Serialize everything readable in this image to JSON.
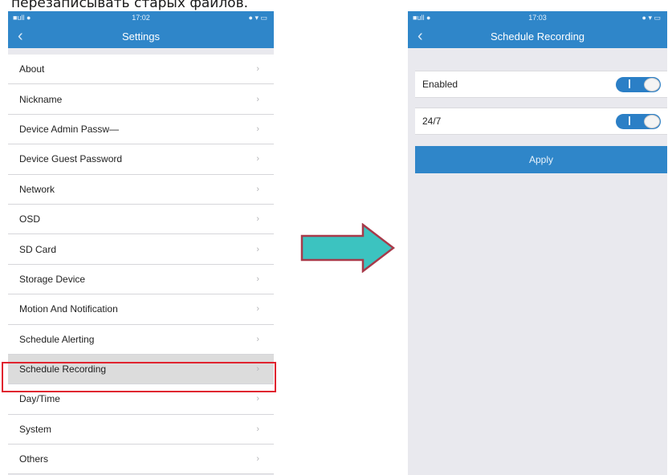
{
  "caption": "перезаписывать старых файлов.",
  "left_screen": {
    "status": {
      "carrier": "■ull ●",
      "time": "17:02",
      "icons": "● ▾ ▭"
    },
    "title": "Settings",
    "back_glyph": "‹",
    "chevron_glyph": "›",
    "items": [
      {
        "label": "About"
      },
      {
        "label": "Nickname"
      },
      {
        "label": "Device Admin Passw—"
      },
      {
        "label": "Device Guest Password"
      },
      {
        "label": "Network"
      },
      {
        "label": "OSD"
      },
      {
        "label": "SD Card"
      },
      {
        "label": "Storage Device"
      },
      {
        "label": "Motion And Notification"
      },
      {
        "label": "Schedule Alerting"
      },
      {
        "label": "Schedule Recording",
        "selected": true
      },
      {
        "label": "Day/Time"
      },
      {
        "label": "System"
      },
      {
        "label": "Others"
      }
    ]
  },
  "right_screen": {
    "status": {
      "carrier": "■ull ●",
      "time": "17:03",
      "icons": "● ▾ ▭"
    },
    "title": "Schedule Recording",
    "back_glyph": "‹",
    "toggles": [
      {
        "label": "Enabled",
        "on": true
      },
      {
        "label": "24/7",
        "on": true
      }
    ],
    "apply_label": "Apply"
  },
  "colors": {
    "header_blue": "#2f86c9",
    "highlight_red": "#e0242f",
    "arrow_fill": "#3cc3c0",
    "arrow_stroke": "#a83a4a"
  }
}
